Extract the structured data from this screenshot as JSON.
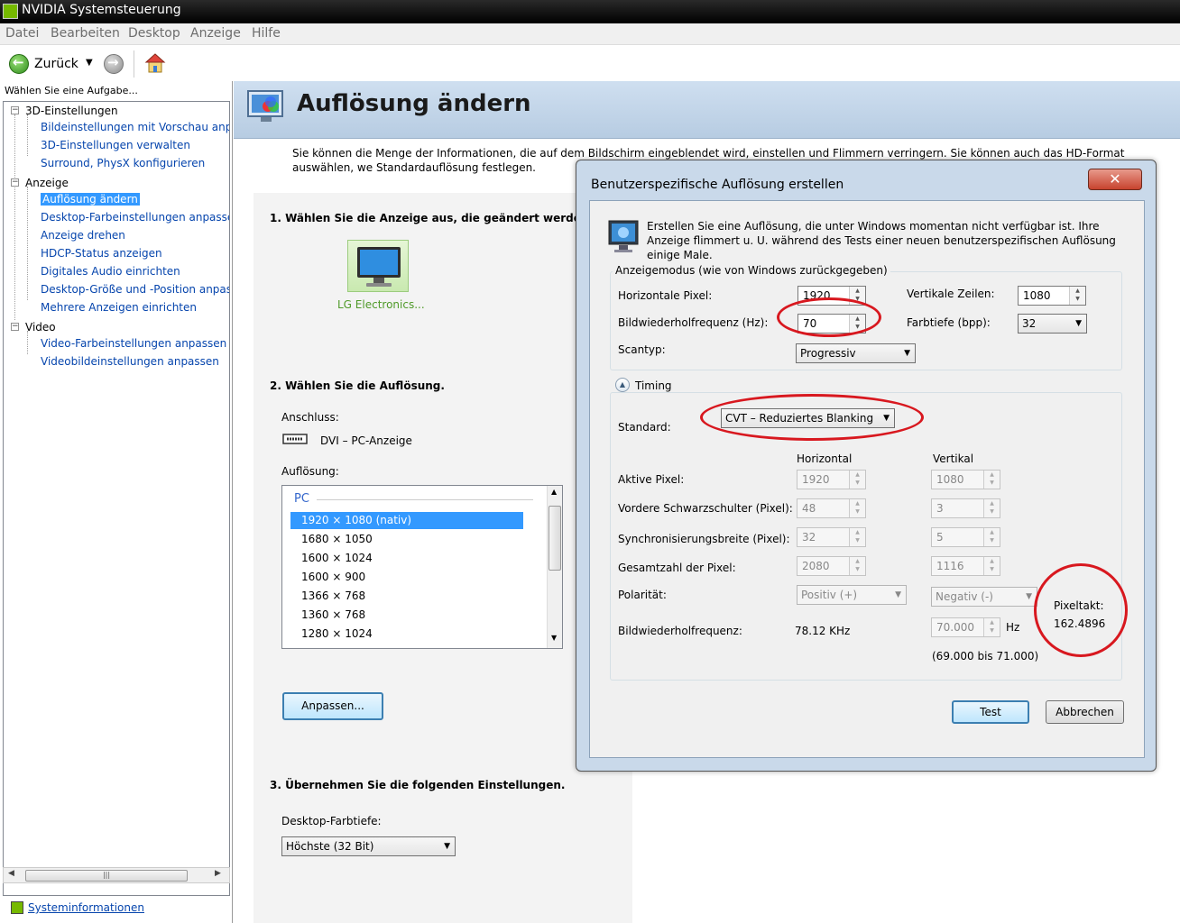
{
  "window": {
    "title": "NVIDIA Systemsteuerung"
  },
  "menu": [
    "Datei",
    "Bearbeiten",
    "Desktop",
    "Anzeige",
    "Hilfe"
  ],
  "toolbar": {
    "back_label": "Zurück"
  },
  "left": {
    "task_label": "Wählen Sie eine Aufgabe...",
    "tree": [
      {
        "label": "3D-Einstellungen",
        "children": [
          "Bildeinstellungen mit Vorschau anpa",
          "3D-Einstellungen verwalten",
          "Surround, PhysX konfigurieren"
        ]
      },
      {
        "label": "Anzeige",
        "children": [
          "Auflösung ändern",
          "Desktop-Farbeinstellungen anpasser",
          "Anzeige drehen",
          "HDCP-Status anzeigen",
          "Digitales Audio einrichten",
          "Desktop-Größe und -Position anpass",
          "Mehrere Anzeigen einrichten"
        ]
      },
      {
        "label": "Video",
        "children": [
          "Video-Farbeinstellungen anpassen",
          "Videobildeinstellungen anpassen"
        ]
      }
    ],
    "selected": "Auflösung ändern",
    "sysinfo": "Systeminformationen"
  },
  "main": {
    "title": "Auflösung ändern",
    "intro": "Sie können die Menge der Informationen, die auf dem Bildschirm eingeblendet wird, einstellen und Flimmern verringern. Sie können auch das HD-Format auswählen, we Standardauflösung festlegen.",
    "step1": "1. Wählen Sie die Anzeige aus, die geändert werden",
    "monitor_label": "LG Electronics...",
    "step2": "2. Wählen Sie die Auflösung.",
    "connection_label": "Anschluss:",
    "connection_value": "DVI – PC-Anzeige",
    "resolution_label": "Auflösung:",
    "res_group": "PC",
    "resolutions": [
      "1920 × 1080 (nativ)",
      "1680 × 1050",
      "1600 × 1024",
      "1600 × 900",
      "1366 × 768",
      "1360 × 768",
      "1280 × 1024"
    ],
    "customize_button": "Anpassen...",
    "step3": "3. Übernehmen Sie die folgenden Einstellungen.",
    "depth_label": "Desktop-Farbtiefe:",
    "depth_value": "Höchste (32 Bit)"
  },
  "dialog": {
    "title": "Benutzerspezifische Auflösung erstellen",
    "close": "✕",
    "description": "Erstellen Sie eine Auflösung, die unter Windows momentan nicht verfügbar ist. Ihre Anzeige flimmert u. U. während des Tests einer neuen benutzerspezifischen Auflösung einige Male.",
    "display_mode_group": "Anzeigemodus (wie von Windows zurückgegeben)",
    "h_pixels_label": "Horizontale Pixel:",
    "h_pixels": "1920",
    "v_lines_label": "Vertikale Zeilen:",
    "v_lines": "1080",
    "refresh_label": "Bildwiederholfrequenz (Hz):",
    "refresh": "70",
    "depth_label": "Farbtiefe (bpp):",
    "depth": "32",
    "scan_label": "Scantyp:",
    "scan": "Progressiv",
    "timing_label": "Timing",
    "standard_label": "Standard:",
    "standard": "CVT – Reduziertes Blanking",
    "col_h": "Horizontal",
    "col_v": "Vertikal",
    "active_label": "Aktive Pixel:",
    "active_h": "1920",
    "active_v": "1080",
    "porch_label": "Vordere Schwarzschulter (Pixel):",
    "porch_h": "48",
    "porch_v": "3",
    "sync_label": "Synchronisierungsbreite (Pixel):",
    "sync_h": "32",
    "sync_v": "5",
    "total_label": "Gesamtzahl der Pixel:",
    "total_h": "2080",
    "total_v": "1116",
    "polarity_label": "Polarität:",
    "polarity_h": "Positiv (+)",
    "polarity_v": "Negativ (-)",
    "freq_label": "Bildwiederholfrequenz:",
    "freq_h": "78.12 KHz",
    "freq_v": "70.000",
    "freq_unit": "Hz",
    "freq_range": "(69.000 bis 71.000)",
    "pixelclock_label": "Pixeltakt:",
    "pixelclock": "162.4896",
    "test_button": "Test",
    "cancel_button": "Abbrechen"
  },
  "colors": {
    "accent": "#3399ff",
    "annotation": "#d8181f",
    "nvidia": "#76b900"
  }
}
